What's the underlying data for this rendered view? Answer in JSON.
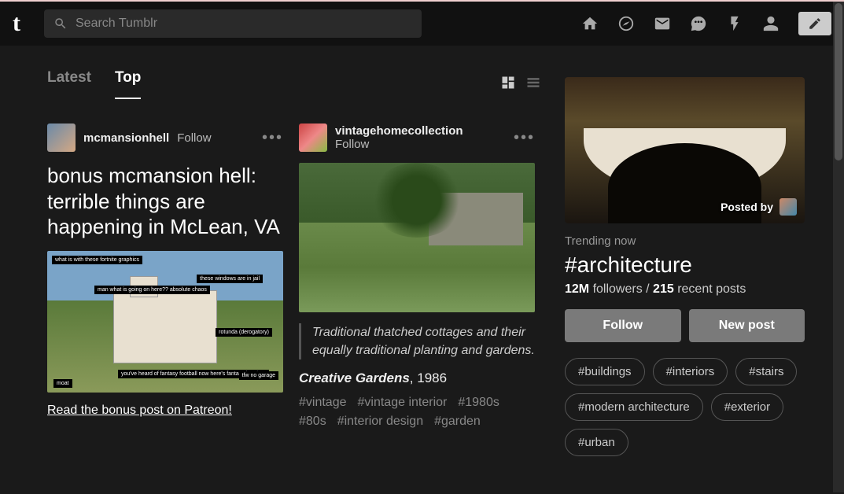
{
  "search": {
    "placeholder": "Search Tumblr"
  },
  "tabs": {
    "latest": "Latest",
    "top": "Top"
  },
  "posts": [
    {
      "username": "mcmansionhell",
      "follow": "Follow",
      "title": "bonus mcmansion hell: terrible things are happening in McLean, VA",
      "link": "Read the bonus post on Patreon!",
      "annotations": {
        "a1": "what is with these fortnite graphics",
        "a2": "man what is going on here?? absolute chaos",
        "a3": "these windows are in jail",
        "a4": "rotunda (derogatory)",
        "a5": "you've heard of fantasy football now here's fantasy interiors",
        "a6": "moat",
        "a7": "tfw no garage"
      }
    },
    {
      "username": "vintagehomecollection",
      "follow": "Follow",
      "quote": "Traditional thatched cottages and their equally traditional planting and gardens.",
      "source_title": "Creative Gardens",
      "source_year": ", 1986",
      "tags": [
        "#vintage",
        "#vintage interior",
        "#1980s",
        "#80s",
        "#interior design",
        "#garden"
      ]
    }
  ],
  "sidebar": {
    "posted_by": "Posted by",
    "trending": "Trending now",
    "hashtag": "#architecture",
    "followers_count": "12M",
    "followers_label": " followers / ",
    "recent_count": "215",
    "recent_label": " recent posts",
    "follow_btn": "Follow",
    "newpost_btn": "New post",
    "related": [
      "#buildings",
      "#interiors",
      "#stairs",
      "#modern architecture",
      "#exterior",
      "#urban"
    ]
  }
}
